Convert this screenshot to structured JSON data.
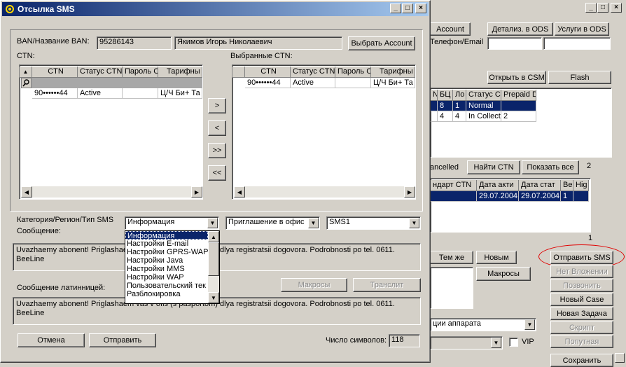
{
  "bg": {
    "account_btn": "Account",
    "details_btn": "Детализ. в ODS",
    "services_btn": "Услуги в ODS",
    "phone_email_label": "Телефон/Email",
    "open_csm_btn": "Открыть в CSM",
    "flash_btn": "Flash",
    "grid1": {
      "headers": [
        "N",
        "БЦ",
        "Ло",
        "Статус С",
        "Prepaid D"
      ],
      "rows": [
        [
          "",
          "8",
          "1",
          "Normal",
          ""
        ],
        [
          "",
          "4",
          "4",
          "In Collecti",
          "2"
        ]
      ]
    },
    "cancelled_label": "ancelled",
    "find_ctn_btn": "Найти CTN",
    "show_all_btn": "Показать все",
    "count_label": "2",
    "grid2": {
      "headers": [
        "ндарт CTN",
        "Дата акти",
        "Дата стат",
        "Ве",
        "Hig"
      ],
      "row": [
        "",
        "29.07.2004",
        "29.07.2004",
        "1",
        ""
      ]
    },
    "page_num": "1",
    "same_btn": "Тем же",
    "new_btn": "Новым",
    "macros_btn": "Макросы",
    "send_sms_btn": "Отправить SMS",
    "no_attachments_btn": "Нет Вложении",
    "call_btn": "Позвонить",
    "new_case_btn": "Новый Case",
    "new_task_btn": "Новая Задача",
    "script_btn": "Скрипт",
    "related_btn": "Попутная",
    "save_btn": "Сохранить",
    "device_combo": "ции аппарата",
    "vip_label": "VIP",
    "highlight_color": "#e00000"
  },
  "dialog": {
    "title": "Отсылка SMS",
    "ban_label": "BAN/Название BAN:",
    "ban_value": "95286143",
    "ban_name": "Якимов Игорь Николаевич",
    "choose_account_btn": "Выбрать Account",
    "ctn_label": "CTN:",
    "selected_ctn_label": "Выбранные CTN:",
    "ctn_headers": [
      "CTN",
      "Статус CTN",
      "Пароль С",
      "Тарифны"
    ],
    "ctn_rows": [
      [
        "90••••••44",
        "Active",
        "",
        "Ц/Ч Би+ Та"
      ]
    ],
    "selected_headers": [
      "CTN",
      "Статус CTN",
      "Пароль С",
      "Тарифны"
    ],
    "selected_rows": [
      [
        "90••••••44",
        "Active",
        "",
        "Ц/Ч Би+ Та"
      ]
    ],
    "move_buttons": [
      ">",
      "<",
      ">>",
      "<<"
    ],
    "category_label": "Категория/Регион/Тип SMS",
    "message_label": "Сообщение:",
    "category_value": "Информация",
    "region_value": "Приглашение в офис",
    "type_value": "SMS1",
    "category_options": [
      "Информация",
      "Настройки E-mail",
      "Настройки GPRS-WAP",
      "Настройки Java",
      "Настройки MMS",
      "Настройки WAP",
      "Пользовательский тек",
      "Разблокировка"
    ],
    "message_text": "Uvazhaemy abonent! Priglashaem vas v ofis (s pasportom) dlya registratsii dogovora. Podrobnosti po tel.  0611. BeeLine",
    "message_visible_start": "Uvazhaemy abonent! Priglashae",
    "message_visible_end": "dlya registratsii dogovora. Podrobnosti po tel.  0611.",
    "message_line2": "BeeLine",
    "latin_label": "Сообщение латинницей:",
    "macros_btn": "Макросы",
    "translit_btn": "Транслит",
    "latin_text_line1": "Uvazhaemy abonent! Priglashaem vas v ofis (s pasportom) dlya registratsii dogovora. Podrobnosti po tel.  0611.",
    "latin_text_line2": "BeeLine",
    "cancel_btn": "Отмена",
    "send_btn": "Отправить",
    "char_count_label": "Число символов:",
    "char_count": "118"
  }
}
